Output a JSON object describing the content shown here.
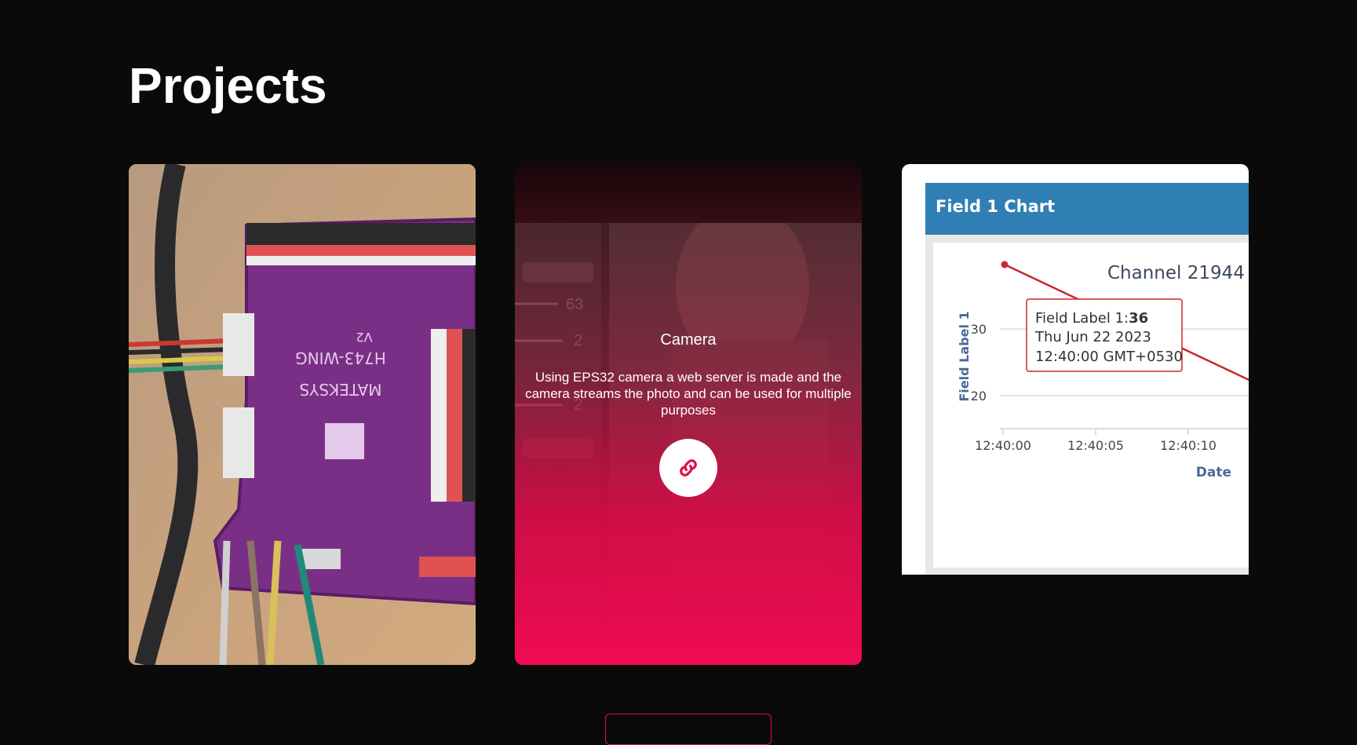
{
  "section": {
    "title": "Projects"
  },
  "cards": [
    {
      "image": "circuit-board-photo",
      "board_text": {
        "brand": "MATEKSYS",
        "model": "H743-WING",
        "version": "V2"
      }
    },
    {
      "title": "Camera",
      "description": "Using EPS32 camera a web server is made and the camera streams the photo and can be used for multiple purposes",
      "link_icon": "link-icon",
      "background_numbers": [
        "63",
        "2",
        "2"
      ]
    },
    {
      "chart_header": "Field 1 Chart"
    }
  ],
  "chart_data": {
    "type": "line",
    "title": "Channel 21944",
    "xlabel": "Date",
    "ylabel": "Field Label 1",
    "x": [
      "12:40:00"
    ],
    "x_ticks": [
      "12:40:00",
      "12:40:05",
      "12:40:10"
    ],
    "y_ticks": [
      20,
      30
    ],
    "series": [
      {
        "values": [
          36
        ]
      }
    ],
    "tooltip": {
      "label": "Field Label 1:",
      "value": "36",
      "date": "Thu Jun 22 2023",
      "time": "12:40:00 GMT+0530"
    },
    "colors": {
      "line": "#c8272d",
      "header": "#2f7eb4"
    }
  },
  "colors": {
    "accent": "#f00b52",
    "background": "#0a0a0b"
  },
  "more_button": {
    "label": ""
  }
}
